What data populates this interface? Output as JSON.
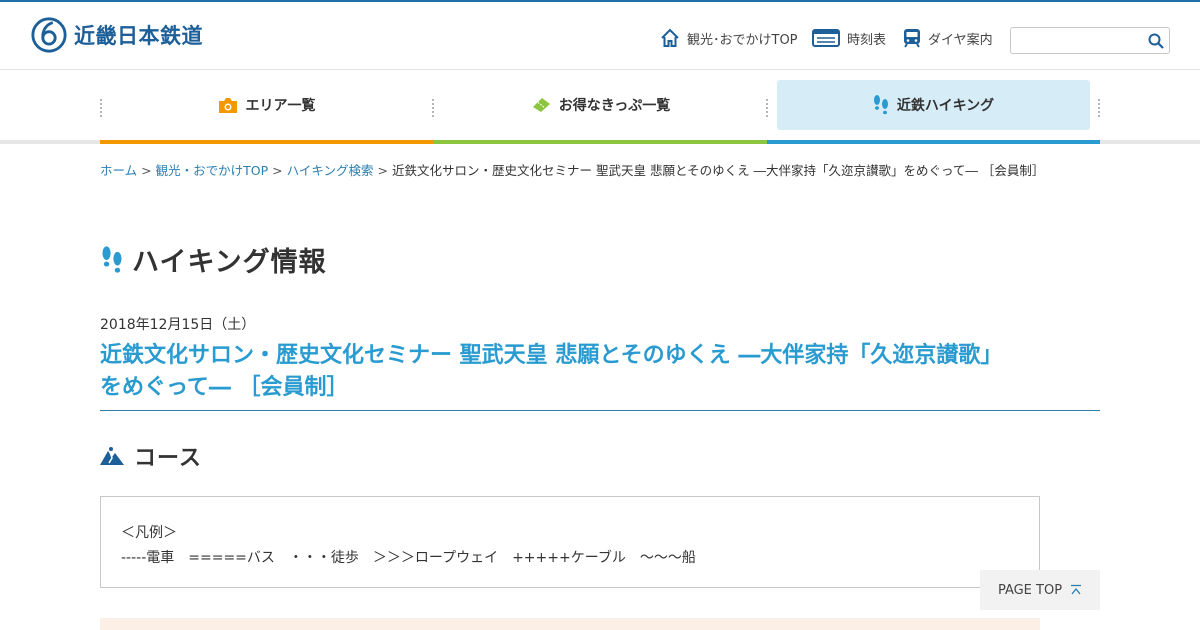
{
  "header": {
    "logo_text": "近畿日本鉄道",
    "nav": [
      {
        "label": "観光･おでかけTOP",
        "icon": "home-icon"
      },
      {
        "label": "時刻表",
        "icon": "timetable-icon"
      },
      {
        "label": "ダイヤ案内",
        "icon": "train-icon"
      }
    ],
    "search": {
      "placeholder": "",
      "value": ""
    }
  },
  "global_nav": [
    {
      "label": "エリア一覧",
      "icon": "camera-icon",
      "accent": "#f39800"
    },
    {
      "label": "お得なきっぷ一覧",
      "icon": "ticket-icon",
      "accent": "#8cc63f"
    },
    {
      "label": "近鉄ハイキング",
      "icon": "footprints-icon",
      "accent": "#2a9bd0",
      "active": true
    }
  ],
  "breadcrumb": [
    {
      "label": "ホーム",
      "link": true
    },
    {
      "label": "観光・おでかけTOP",
      "link": true
    },
    {
      "label": "ハイキング検索",
      "link": true
    },
    {
      "label": "近鉄文化サロン・歴史文化セミナー 聖武天皇 悲願とそのゆくえ ―大伴家持「久迩京讃歌」をめぐって― ［会員制］",
      "link": false
    }
  ],
  "page": {
    "title": "ハイキング情報",
    "date": "2018年12月15日（土）",
    "event_title_line1": "近鉄文化サロン・歴史文化セミナー 聖武天皇 悲願とそのゆくえ ―大伴家持「久迩京讃歌」",
    "event_title_line2": "をめぐって― ［会員制］",
    "course_heading": "コース",
    "legend_title": "＜凡例＞",
    "legend_text": "-----電車　=====バス　・・・徒歩　＞＞＞ロープウェイ　+++++ケーブル　〜〜〜船"
  },
  "page_top": {
    "label": "PAGE TOP"
  },
  "colors": {
    "brand": "#1d5f98",
    "accent_blue": "#2a9bd0",
    "orange": "#f39800",
    "green": "#8cc63f"
  }
}
